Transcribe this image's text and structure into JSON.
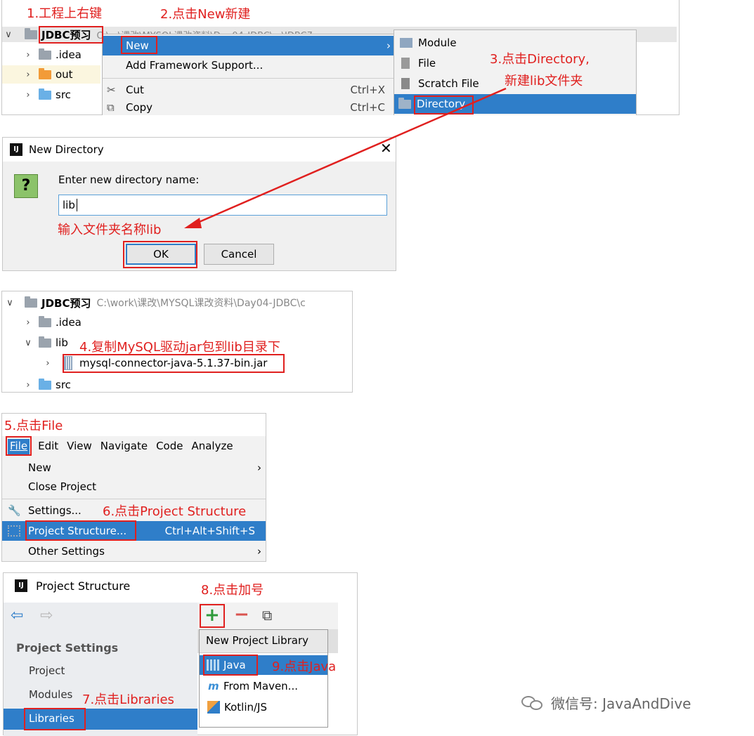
{
  "annotations": {
    "a1": "1.工程上右键",
    "a2": "2.点击New新建",
    "a3_l1": "3.点击Directory,",
    "a3_l2": "新建lib文件夹",
    "a_input": "输入文件夹名称lib",
    "a4": "4.复制MySQL驱动jar包到lib目录下",
    "a5": "5.点击File",
    "a6": "6.点击Project Structure",
    "a7": "7.点击Libraries",
    "a8": "8.点击加号",
    "a9": "9.点击Java"
  },
  "panel1": {
    "project_name": "JDBC预习",
    "project_path": "C:\\...\\课改\\MYSQL课改资料\\D... 04-JDBC\\...\\JDBC7",
    "tree": [
      {
        "label": ".idea"
      },
      {
        "label": "out"
      },
      {
        "label": "src"
      }
    ],
    "context_menu": {
      "new": "New",
      "add_framework": "Add Framework Support...",
      "cut": "Cut",
      "cut_shortcut": "Ctrl+X",
      "copy": "Copy",
      "copy_shortcut": "Ctrl+C"
    },
    "submenu": {
      "module": "Module",
      "file": "File",
      "scratch": "Scratch File",
      "directory": "Directory"
    }
  },
  "dialog": {
    "title": "New Directory",
    "prompt": "Enter new directory name:",
    "value": "lib",
    "ok": "OK",
    "cancel": "Cancel"
  },
  "panel3": {
    "project_name": "JDBC预习",
    "project_path": "C:\\work\\课改\\MYSQL课改资料\\Day04-JDBC\\c",
    "idea": ".idea",
    "lib": "lib",
    "jar": "mysql-connector-java-5.1.37-bin.jar",
    "src": "src"
  },
  "panel4": {
    "menubar": [
      "File",
      "Edit",
      "View",
      "Navigate",
      "Code",
      "Analyze"
    ],
    "items": {
      "new": "New",
      "close": "Close Project",
      "settings": "Settings...",
      "structure": "Project Structure...",
      "structure_shortcut": "Ctrl+Alt+Shift+S",
      "other": "Other Settings"
    }
  },
  "panel5": {
    "title": "Project Structure",
    "section": "Project Settings",
    "nav": [
      "Project",
      "Modules",
      "Libraries"
    ],
    "popup_title": "New Project Library",
    "popup_items": [
      "Java",
      "From Maven...",
      "Kotlin/JS"
    ]
  },
  "watermark": "微信号: JavaAndDive",
  "colors": {
    "accent": "#2f7ec9",
    "annotation": "#e0201f"
  }
}
